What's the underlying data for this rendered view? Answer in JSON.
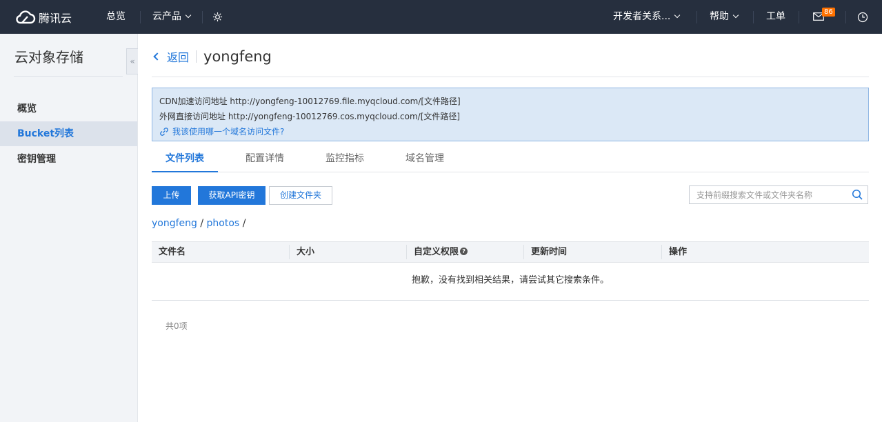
{
  "topbar": {
    "logo_text": "腾讯云",
    "overview": "总览",
    "products": "云产品",
    "developer": "开发者关系...",
    "help": "帮助",
    "ticket": "工单",
    "mail_count": "86"
  },
  "sidebar": {
    "title": "云对象存储",
    "items": [
      {
        "label": "概览"
      },
      {
        "label": "Bucket列表"
      },
      {
        "label": "密钥管理"
      }
    ],
    "collapse_glyph": "«"
  },
  "header": {
    "back_label": "返回",
    "bucket_name": "yongfeng"
  },
  "info": {
    "cdn": "CDN加速访问地址 http://yongfeng-10012769.file.myqcloud.com/[文件路径]",
    "direct": "外网直接访问地址 http://yongfeng-10012769.cos.myqcloud.com/[文件路径]",
    "help_link": "我该使用哪一个域名访问文件?"
  },
  "tabs": [
    {
      "label": "文件列表"
    },
    {
      "label": "配置详情"
    },
    {
      "label": "监控指标"
    },
    {
      "label": "域名管理"
    }
  ],
  "toolbar": {
    "upload": "上传",
    "get_api_key": "获取API密钥",
    "create_folder": "创建文件夹",
    "search_placeholder": "支持前缀搜索文件或文件夹名称"
  },
  "breadcrumb": {
    "root": "yongfeng",
    "folder": "photos"
  },
  "table": {
    "columns": [
      "文件名",
      "大小",
      "自定义权限",
      "更新时间",
      "操作"
    ],
    "empty_message": "抱歉，没有找到相关结果，请尝试其它搜索条件。"
  },
  "footer": {
    "total": "共0项"
  },
  "colors": {
    "nav_bg": "#262f3e",
    "accent": "#2277da",
    "badge": "#ff7200",
    "info_bg": "#dbe8f6"
  }
}
